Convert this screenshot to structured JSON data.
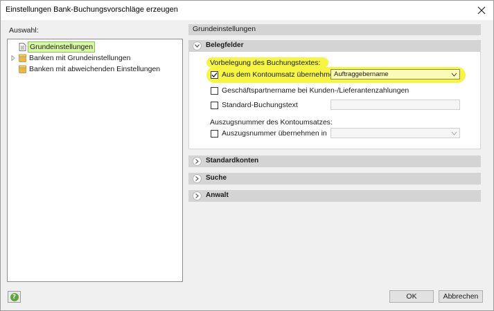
{
  "window": {
    "title": "Einstellungen Bank-Buchungsvorschläge erzeugen"
  },
  "left": {
    "label": "Auswahl:",
    "tree": [
      {
        "label": "Grundeinstellungen",
        "icon": "document-icon",
        "selected": true
      },
      {
        "label": "Banken mit Grundeinstellungen",
        "icon": "folder-icon",
        "expandable": true
      },
      {
        "label": "Banken mit abweichenden Einstellungen",
        "icon": "folder-icon"
      }
    ]
  },
  "right": {
    "header": "Grundeinstellungen",
    "sections": {
      "belegfelder": "Belegfelder",
      "standardkonten": "Standardkonten",
      "suche": "Suche",
      "anwalt": "Anwalt"
    },
    "buchungstext": {
      "group_label": "Vorbelegung des Buchungstextes:",
      "kontoumsatz": {
        "label": "Aus dem Kontoumsatz übernehmen",
        "checked": true,
        "select_value": "Auftraggebername"
      },
      "geschaeftspartner": {
        "label": "Geschäftspartnername bei Kunden-/Lieferantenzahlungen",
        "checked": false
      },
      "standard": {
        "label": "Standard-Buchungstext",
        "checked": false,
        "value": ""
      }
    },
    "auszug": {
      "group_label": "Auszugsnummer des Kontoumsatzes:",
      "uebernehmen": {
        "label": "Auszugsnummer übernehmen in",
        "checked": false,
        "select_value": ""
      }
    }
  },
  "footer": {
    "ok": "OK",
    "cancel": "Abbrechen",
    "help": "?"
  },
  "colors": {
    "highlight": "#f5f542",
    "selection": "#d7f7a6",
    "help": "#5ea63a"
  }
}
